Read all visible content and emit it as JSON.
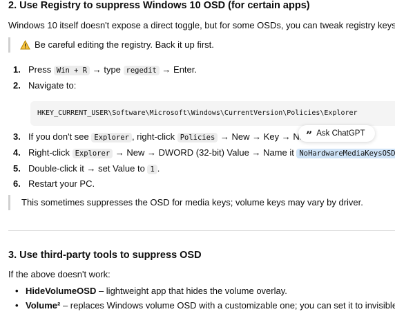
{
  "section2": {
    "heading": "2. Use Registry to suppress Windows 10 OSD (for certain apps)",
    "intro": "Windows 10 itself doesn't expose a direct toggle, but for some OSDs, you can tweak registry keys.",
    "warning": "Be careful editing the registry. Back it up first.",
    "steps": [
      {
        "num": "1.",
        "a": "Press ",
        "code1": "Win + R",
        "b": " → type ",
        "code2": "regedit",
        "c": " → Enter."
      },
      {
        "num": "2.",
        "text": "Navigate to:"
      },
      {
        "num": "3.",
        "a": "If you don't see ",
        "code1": "Explorer",
        "b": ", right-click ",
        "code2": "Policies",
        "c": " → New → Key → Nam"
      },
      {
        "num": "4.",
        "a": "Right-click ",
        "code1": "Explorer",
        "b": " → New → DWORD (32-bit) Value → Name it ",
        "code2": "NoHardwareMediaKeysOSD",
        "c": "."
      },
      {
        "num": "5.",
        "a": "Double-click it → set Value to ",
        "code1": "1",
        "c": "."
      },
      {
        "num": "6.",
        "text": "Restart your PC."
      }
    ],
    "registry_path": "HKEY_CURRENT_USER\\Software\\Microsoft\\Windows\\CurrentVersion\\Policies\\Explorer",
    "note": "This sometimes suppresses the OSD for media keys; volume keys may vary by driver."
  },
  "ask_chip": {
    "label": "Ask ChatGPT"
  },
  "section3": {
    "heading": "3. Use third-party tools to suppress OSD",
    "intro": "If the above doesn't work:",
    "bullets": [
      {
        "name": "HideVolumeOSD",
        "rest": " – lightweight app that hides the volume overlay."
      },
      {
        "name": "Volume²",
        "rest": " – replaces Windows volume OSD with a customizable one; you can set it to invisible."
      }
    ]
  }
}
